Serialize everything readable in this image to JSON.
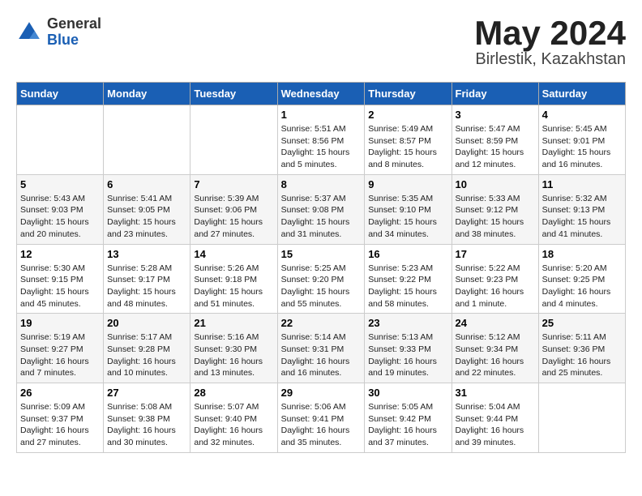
{
  "header": {
    "logo_general": "General",
    "logo_blue": "Blue",
    "month_year": "May 2024",
    "location": "Birlestik, Kazakhstan"
  },
  "days_of_week": [
    "Sunday",
    "Monday",
    "Tuesday",
    "Wednesday",
    "Thursday",
    "Friday",
    "Saturday"
  ],
  "weeks": [
    [
      {
        "day": "",
        "info": ""
      },
      {
        "day": "",
        "info": ""
      },
      {
        "day": "",
        "info": ""
      },
      {
        "day": "1",
        "info": "Sunrise: 5:51 AM\nSunset: 8:56 PM\nDaylight: 15 hours\nand 5 minutes."
      },
      {
        "day": "2",
        "info": "Sunrise: 5:49 AM\nSunset: 8:57 PM\nDaylight: 15 hours\nand 8 minutes."
      },
      {
        "day": "3",
        "info": "Sunrise: 5:47 AM\nSunset: 8:59 PM\nDaylight: 15 hours\nand 12 minutes."
      },
      {
        "day": "4",
        "info": "Sunrise: 5:45 AM\nSunset: 9:01 PM\nDaylight: 15 hours\nand 16 minutes."
      }
    ],
    [
      {
        "day": "5",
        "info": "Sunrise: 5:43 AM\nSunset: 9:03 PM\nDaylight: 15 hours\nand 20 minutes."
      },
      {
        "day": "6",
        "info": "Sunrise: 5:41 AM\nSunset: 9:05 PM\nDaylight: 15 hours\nand 23 minutes."
      },
      {
        "day": "7",
        "info": "Sunrise: 5:39 AM\nSunset: 9:06 PM\nDaylight: 15 hours\nand 27 minutes."
      },
      {
        "day": "8",
        "info": "Sunrise: 5:37 AM\nSunset: 9:08 PM\nDaylight: 15 hours\nand 31 minutes."
      },
      {
        "day": "9",
        "info": "Sunrise: 5:35 AM\nSunset: 9:10 PM\nDaylight: 15 hours\nand 34 minutes."
      },
      {
        "day": "10",
        "info": "Sunrise: 5:33 AM\nSunset: 9:12 PM\nDaylight: 15 hours\nand 38 minutes."
      },
      {
        "day": "11",
        "info": "Sunrise: 5:32 AM\nSunset: 9:13 PM\nDaylight: 15 hours\nand 41 minutes."
      }
    ],
    [
      {
        "day": "12",
        "info": "Sunrise: 5:30 AM\nSunset: 9:15 PM\nDaylight: 15 hours\nand 45 minutes."
      },
      {
        "day": "13",
        "info": "Sunrise: 5:28 AM\nSunset: 9:17 PM\nDaylight: 15 hours\nand 48 minutes."
      },
      {
        "day": "14",
        "info": "Sunrise: 5:26 AM\nSunset: 9:18 PM\nDaylight: 15 hours\nand 51 minutes."
      },
      {
        "day": "15",
        "info": "Sunrise: 5:25 AM\nSunset: 9:20 PM\nDaylight: 15 hours\nand 55 minutes."
      },
      {
        "day": "16",
        "info": "Sunrise: 5:23 AM\nSunset: 9:22 PM\nDaylight: 15 hours\nand 58 minutes."
      },
      {
        "day": "17",
        "info": "Sunrise: 5:22 AM\nSunset: 9:23 PM\nDaylight: 16 hours\nand 1 minute."
      },
      {
        "day": "18",
        "info": "Sunrise: 5:20 AM\nSunset: 9:25 PM\nDaylight: 16 hours\nand 4 minutes."
      }
    ],
    [
      {
        "day": "19",
        "info": "Sunrise: 5:19 AM\nSunset: 9:27 PM\nDaylight: 16 hours\nand 7 minutes."
      },
      {
        "day": "20",
        "info": "Sunrise: 5:17 AM\nSunset: 9:28 PM\nDaylight: 16 hours\nand 10 minutes."
      },
      {
        "day": "21",
        "info": "Sunrise: 5:16 AM\nSunset: 9:30 PM\nDaylight: 16 hours\nand 13 minutes."
      },
      {
        "day": "22",
        "info": "Sunrise: 5:14 AM\nSunset: 9:31 PM\nDaylight: 16 hours\nand 16 minutes."
      },
      {
        "day": "23",
        "info": "Sunrise: 5:13 AM\nSunset: 9:33 PM\nDaylight: 16 hours\nand 19 minutes."
      },
      {
        "day": "24",
        "info": "Sunrise: 5:12 AM\nSunset: 9:34 PM\nDaylight: 16 hours\nand 22 minutes."
      },
      {
        "day": "25",
        "info": "Sunrise: 5:11 AM\nSunset: 9:36 PM\nDaylight: 16 hours\nand 25 minutes."
      }
    ],
    [
      {
        "day": "26",
        "info": "Sunrise: 5:09 AM\nSunset: 9:37 PM\nDaylight: 16 hours\nand 27 minutes."
      },
      {
        "day": "27",
        "info": "Sunrise: 5:08 AM\nSunset: 9:38 PM\nDaylight: 16 hours\nand 30 minutes."
      },
      {
        "day": "28",
        "info": "Sunrise: 5:07 AM\nSunset: 9:40 PM\nDaylight: 16 hours\nand 32 minutes."
      },
      {
        "day": "29",
        "info": "Sunrise: 5:06 AM\nSunset: 9:41 PM\nDaylight: 16 hours\nand 35 minutes."
      },
      {
        "day": "30",
        "info": "Sunrise: 5:05 AM\nSunset: 9:42 PM\nDaylight: 16 hours\nand 37 minutes."
      },
      {
        "day": "31",
        "info": "Sunrise: 5:04 AM\nSunset: 9:44 PM\nDaylight: 16 hours\nand 39 minutes."
      },
      {
        "day": "",
        "info": ""
      }
    ]
  ]
}
